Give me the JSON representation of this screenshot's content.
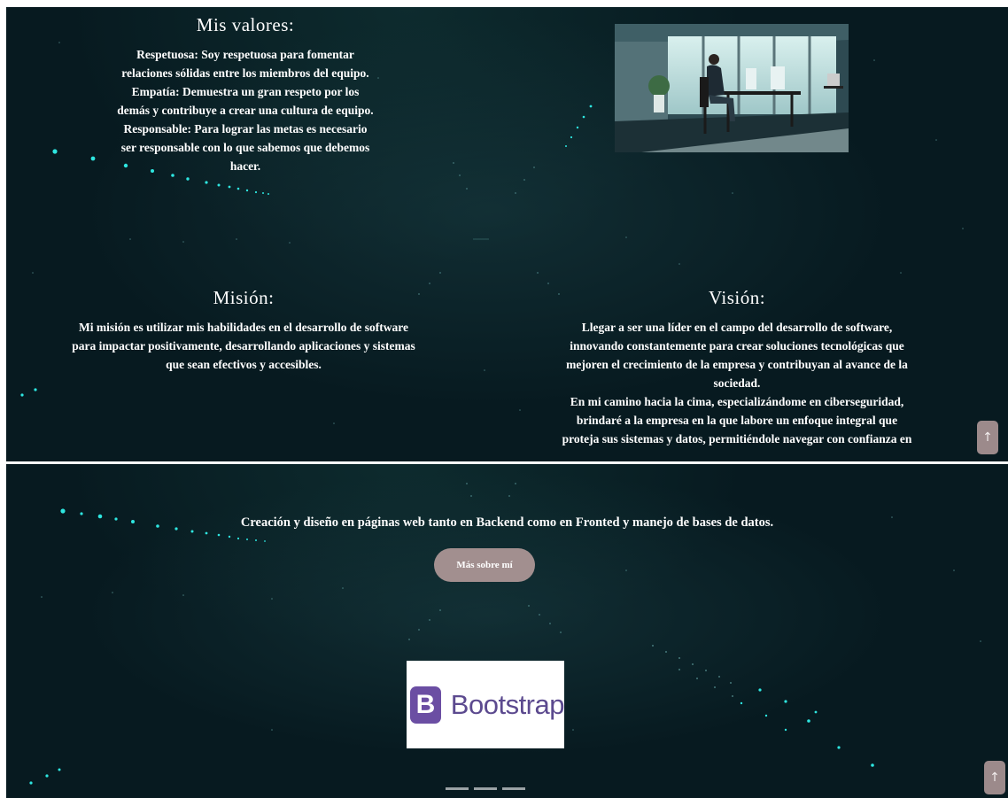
{
  "values": {
    "title": "Mis valores:",
    "lines": [
      "Respetuosa: Soy respetuosa para fomentar",
      "relaciones sólidas entre los miembros del equipo.",
      "Empatía: Demuestra un gran respeto por los",
      "demás y contribuye a crear una cultura de equipo.",
      "Responsable: Para lograr las metas es necesario",
      "ser responsable con lo que sabemos que debemos",
      "hacer."
    ]
  },
  "mission": {
    "title": "Misión:",
    "lines": [
      "Mi misión es utilizar mis habilidades en el desarrollo de software",
      "para impactar positivamente, desarrollando aplicaciones y sistemas",
      "que sean efectivos y accesibles."
    ]
  },
  "vision": {
    "title": "Visión:",
    "lines": [
      "Llegar a ser una líder en el campo del desarrollo de software,",
      "innovando constantemente para crear soluciones tecnológicas que",
      "mejoren el crecimiento de la empresa y contribuyan al avance de la",
      "sociedad.",
      "En mi camino hacia la cima, especializándome en ciberseguridad,",
      "brindaré a la empresa en la que labore un enfoque integral que",
      "proteja sus sistemas y datos, permitiéndole navegar con confianza en"
    ]
  },
  "scroll_top": {
    "icon": "arrow-up-icon",
    "glyph": "↑"
  },
  "about": {
    "tagline": "Creación y diseño en páginas web tanto en Backend como en Fronted y manejo de bases de datos.",
    "button_label": "Más sobre mí"
  },
  "carousel": {
    "logo_mark": "B",
    "logo_word": "Bootstrap",
    "indicator_count": 3
  },
  "colors": {
    "background": "#071a20",
    "star_accent": "#2ee6e0",
    "button": "#a28f8f",
    "scroll_button": "#9c8a8b",
    "bootstrap_purple": "#6b4ea3"
  }
}
